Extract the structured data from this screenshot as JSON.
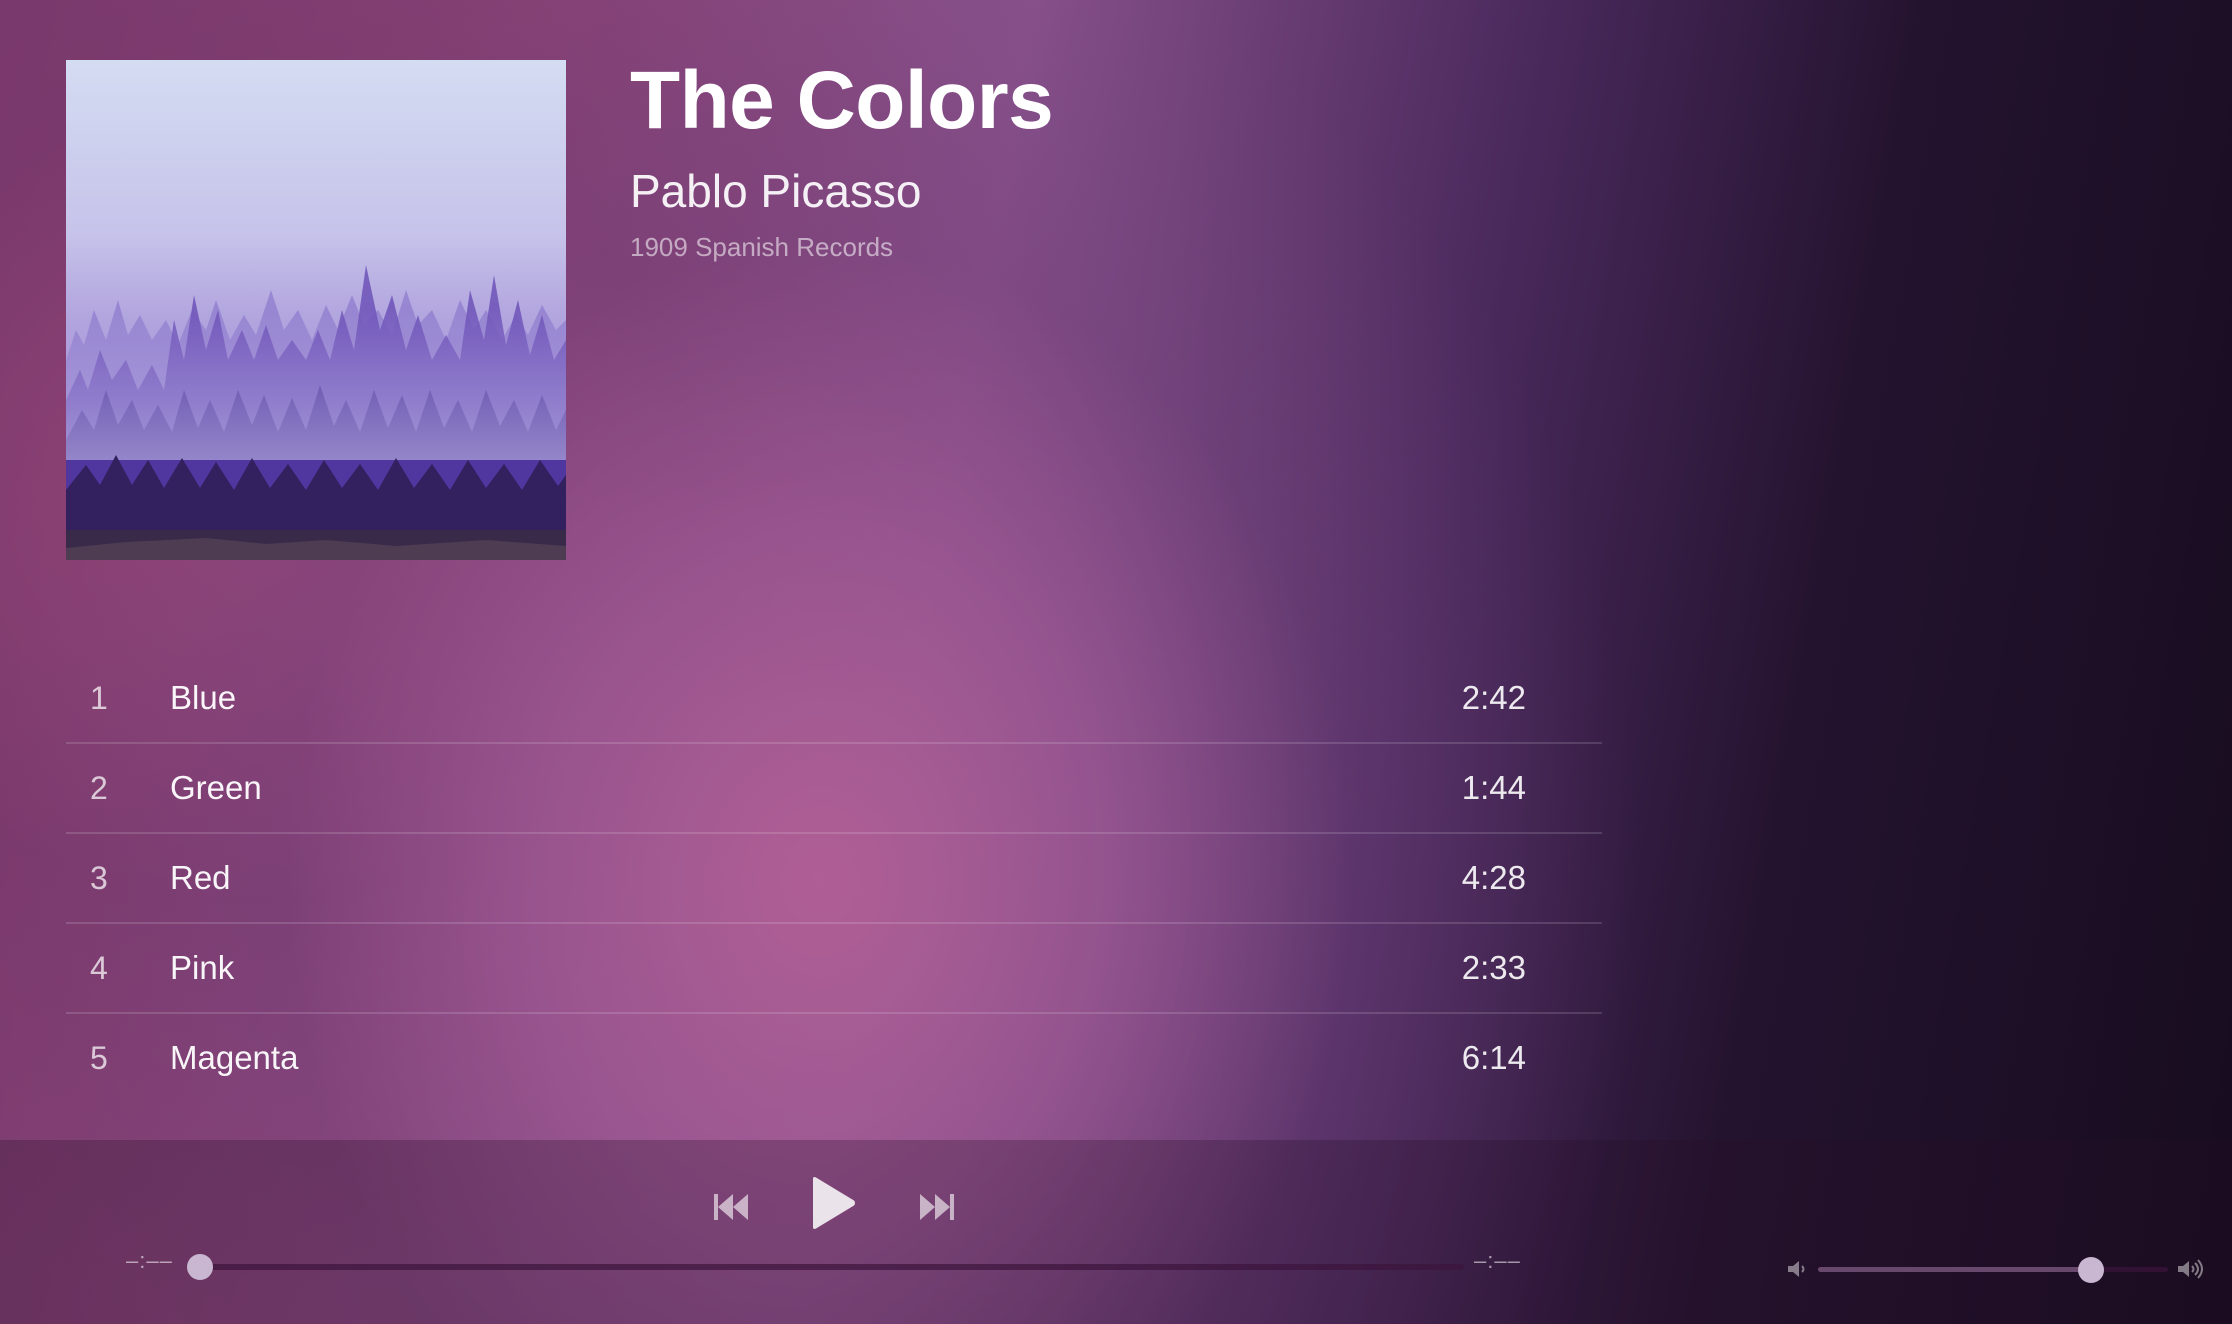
{
  "album": {
    "title": "The Colors",
    "artist": "Pablo Picasso",
    "meta": "1909 Spanish Records",
    "art_icon": "misty-forest-album-art"
  },
  "tracks": [
    {
      "number": "1",
      "title": "Blue",
      "duration": "2:42"
    },
    {
      "number": "2",
      "title": "Green",
      "duration": "1:44"
    },
    {
      "number": "3",
      "title": "Red",
      "duration": "4:28"
    },
    {
      "number": "4",
      "title": "Pink",
      "duration": "2:33"
    },
    {
      "number": "5",
      "title": "Magenta",
      "duration": "6:14"
    }
  ],
  "player": {
    "elapsed": "–:––",
    "remaining": "–:––",
    "progress": 0,
    "volume": 0.78,
    "icons": {
      "prev": "skip-previous-icon",
      "play": "play-icon",
      "next": "skip-next-icon",
      "volume_low": "volume-low-icon",
      "volume_high": "volume-high-icon"
    }
  },
  "colors": {
    "text": "#ffffff",
    "muted_text": "#c9b1cf",
    "thumb": "#c9b7d2",
    "accent_pink": "#a85a8f",
    "dark": "#170c1f"
  }
}
